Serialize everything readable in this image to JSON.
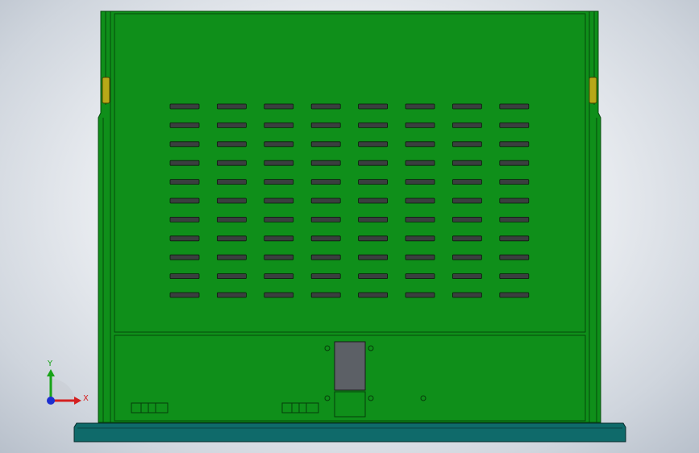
{
  "viewport": {
    "background_center": "#ffffff",
    "background_edge": "#b8c0cb"
  },
  "model": {
    "panel_color": "#0f8f1a",
    "panel_edge_color": "#064a0b",
    "base_color": "#0f6a6a",
    "slot_color": "#3a3f3f",
    "hinge_color": "#b8a818",
    "connector_color": "#5c6066",
    "vent_rows": 11,
    "vent_cols": 8
  },
  "triad": {
    "x_label": "X",
    "y_label": "Y",
    "x_color": "#d42020",
    "y_color": "#17a317",
    "z_color": "#1c2fd0"
  }
}
